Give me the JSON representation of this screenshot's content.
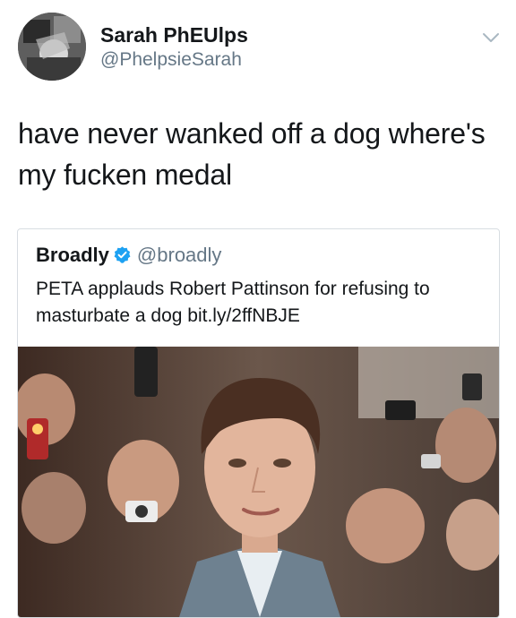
{
  "tweet": {
    "author_name": "Sarah PhEUlps",
    "author_handle": "@PhelpsieSarah",
    "text": "have never wanked off a dog where's my fucken medal"
  },
  "quoted_tweet": {
    "author_name": "Broadly",
    "author_handle": "@broadly",
    "text": "PETA applauds Robert Pattinson for refusing to masturbate a dog bit.ly/2ffNBJE"
  },
  "icons": {
    "caret": "chevron-down-icon",
    "verified": "verified-badge-icon"
  },
  "colors": {
    "text": "#14171a",
    "secondary_text": "#657786",
    "verified_blue": "#1da1f2",
    "border": "#d8dde2"
  }
}
